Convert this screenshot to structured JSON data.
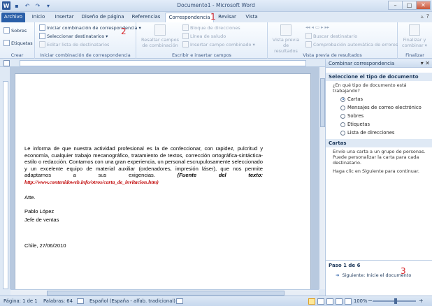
{
  "window": {
    "title": "Documento1 - Microsoft Word",
    "minimize": "–",
    "maximize": "□",
    "close": "✕"
  },
  "qat": {
    "word": "W",
    "save": "▪",
    "undo": "↶",
    "redo": "↷",
    "more": "▾"
  },
  "tabs": [
    "Archivo",
    "Inicio",
    "Insertar",
    "Diseño de página",
    "Referencias",
    "Correspondencia",
    "Revisar",
    "Vista"
  ],
  "tab_right": {
    "minimize": "▵",
    "help": "?"
  },
  "ribbon": {
    "crear": {
      "label": "Crear",
      "sobres": "Sobres",
      "etiquetas": "Etiquetas"
    },
    "iniciar": {
      "label": "Iniciar combinación de correspondencia",
      "iniciar_btn": "Iniciar combinación de correspondencia ▾",
      "seleccionar_btn": "Seleccionar destinatarios ▾",
      "editar_btn": "Editar lista de destinatarios"
    },
    "escribir": {
      "label": "Escribir e insertar campos",
      "resaltar": "Resaltar campos de combinación",
      "bloque": "Bloque de direcciones",
      "linea": "Línea de saludo",
      "insertar_campo": "Insertar campo combinado ▾"
    },
    "vista": {
      "label": "Vista previa de resultados",
      "vista_previa": "Vista previa de resultados",
      "buscar": "Buscar destinatario",
      "comprobacion": "Comprobación automática de errores"
    },
    "finalizar": {
      "label": "Finalizar",
      "btn": "Finalizar y combinar ▾"
    }
  },
  "annotations": [
    "1",
    "2",
    "3"
  ],
  "document": {
    "paragraph": "Le informa de que nuestra actividad profesional es la de confeccionar, con rapidez, pulcritud y economía, cualquier trabajo mecanográfico, tratamiento de textos, corrección ortográfica-sintáctica-estilo o redacción. Contamos con una gran experiencia, un personal escrupulosamente seleccionado y un excelente equipo de material auxiliar (ordenadores, impresión láser), que nos permite adaptarnos a sus exigencias.",
    "fuente": "(Fuente del texto:",
    "url": "http://www.contenidoweb.info/otros/carta_de_invitacion.htm)",
    "closing": "Atte.",
    "name": "Pablo López",
    "role": "Jefe de ventas",
    "place_date": "Chile, 27/06/2010"
  },
  "pane": {
    "title": "Combinar correspondencia",
    "section1": "Seleccione el tipo de documento",
    "question": "¿En qué tipo de documento está trabajando?",
    "options": [
      "Cartas",
      "Mensajes de correo electrónico",
      "Sobres",
      "Etiquetas",
      "Lista de direcciones"
    ],
    "selected": 0,
    "section2": "Cartas",
    "desc": "Envíe una carta a un grupo de personas. Puede personalizar la carta para cada destinatario.",
    "hint": "Haga clic en Siguiente para continuar.",
    "step": "Paso 1 de 6",
    "next": "Siguiente: Inicie el documento"
  },
  "status": {
    "page": "Página: 1 de 1",
    "words": "Palabras: 64",
    "lang": "Español (España - alfab. tradicional)",
    "zoom": "100%",
    "zoom_minus": "−",
    "zoom_plus": "+"
  },
  "colors": {
    "file_tab": "#2a5fa8",
    "annotation": "#d7262b",
    "source_url": "#c00000"
  }
}
